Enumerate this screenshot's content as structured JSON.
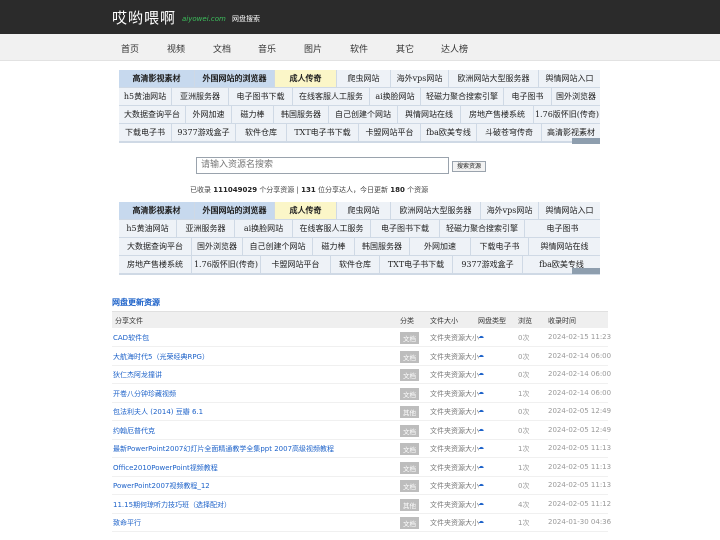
{
  "header": {
    "brand": "哎哟喂啊",
    "brand_sub": "aiyowei.com",
    "tagline": "网盘搜索"
  },
  "nav": [
    "首页",
    "视频",
    "文档",
    "音乐",
    "图片",
    "软件",
    "其它",
    "达人榜"
  ],
  "link_grid_top": [
    [
      "高清影视素材",
      "外国网站的浏览器",
      "成人传奇",
      "爬虫网站",
      "海外vps网站",
      "欧洲网站大型服务器",
      "舆情网站入口"
    ],
    [
      "h5黄油网站",
      "亚洲服务器",
      "电子图书下载",
      "在线客服人工服务",
      "ai换脸网站",
      "轻磁力聚合搜索引擎",
      "电子图书",
      "国外浏览器"
    ],
    [
      "大数据查询平台",
      "外网加速",
      "磁力棒",
      "韩国服务器",
      "自己创建个网站",
      "舆情网站在线",
      "房地产售楼系统",
      "1.76版怀旧(传奇)"
    ],
    [
      "下载电子书",
      "9377游戏盒子",
      "软件仓库",
      "TXT电子书下载",
      "卡盟网站平台",
      "fba欧美专线",
      "斗破苍穹传奇",
      "高清影视素材"
    ]
  ],
  "search": {
    "placeholder": "请输入资源名搜索",
    "button": "搜索资源"
  },
  "stats": {
    "prefix": "已收录",
    "resources": "111049029",
    "mid1": "个分享资源 |",
    "users": "131",
    "mid2": "位分享达人，今日更新",
    "today": "180",
    "suffix": "个资源"
  },
  "link_grid_bottom": [
    [
      "高清影视素材",
      "外国网站的浏览器",
      "成人传奇",
      "爬虫网站",
      "欧洲网站大型服务器",
      "海外vps网站",
      "舆情网站入口"
    ],
    [
      "h5黄油网站",
      "亚洲服务器",
      "ai换脸网站",
      "在线客服人工服务",
      "电子图书下载",
      "轻磁力聚合搜索引擎",
      "电子图书"
    ],
    [
      "大数据查询平台",
      "国外浏览器",
      "自己创建个网站",
      "磁力棒",
      "韩国服务器",
      "外网加速",
      "下载电子书",
      "舆情网站在线"
    ],
    [
      "房地产售楼系统",
      "1.76版怀旧(传奇)",
      "卡盟网站平台",
      "软件仓库",
      "TXT电子书下载",
      "9377游戏盒子",
      "fba欧美专线"
    ]
  ],
  "table": {
    "title": "网盘更新资源",
    "headers": [
      "分享文件",
      "分类",
      "文件大小",
      "网盘类型",
      "浏览",
      "收录时间"
    ],
    "rows": [
      {
        "name": "CAD软件包",
        "cat": "文档",
        "size": "文件夹资源大小",
        "views": "0次",
        "time": "2024-02-15 11:23"
      },
      {
        "name": "大航海时代5（光荣经典RPG）",
        "cat": "文档",
        "size": "文件夹资源大小",
        "views": "0次",
        "time": "2024-02-14 06:00"
      },
      {
        "name": "狄仁杰阿龙撞讲",
        "cat": "文档",
        "size": "文件夹资源大小",
        "views": "0次",
        "time": "2024-02-14 06:00"
      },
      {
        "name": "开卷八分钟珍藏视频",
        "cat": "文档",
        "size": "文件夹资源大小",
        "views": "1次",
        "time": "2024-02-14 06:00"
      },
      {
        "name": "包法利夫人 (2014) 豆瓣 6.1",
        "cat": "其他",
        "size": "文件夹资源大小",
        "views": "0次",
        "time": "2024-02-05 12:49"
      },
      {
        "name": "约翰厄普代克",
        "cat": "文档",
        "size": "文件夹资源大小",
        "views": "0次",
        "time": "2024-02-05 12:49"
      },
      {
        "name": "最新PowerPoint2007幻灯片全面精通教学全集ppt 2007高级视频教程",
        "cat": "文档",
        "size": "文件夹资源大小",
        "views": "1次",
        "time": "2024-02-05 11:13"
      },
      {
        "name": "Office2010PowerPoint视频教程",
        "cat": "文档",
        "size": "文件夹资源大小",
        "views": "1次",
        "time": "2024-02-05 11:13"
      },
      {
        "name": "PowerPoint2007视频教程_12",
        "cat": "文档",
        "size": "文件夹资源大小",
        "views": "0次",
        "time": "2024-02-05 11:13"
      },
      {
        "name": "11.15期何琼听力技巧班（选择配对）",
        "cat": "其他",
        "size": "文件夹资源大小",
        "views": "4次",
        "time": "2024-02-05 11:12"
      },
      {
        "name": "致命平行",
        "cat": "文档",
        "size": "文件夹资源大小",
        "views": "1次",
        "time": "2024-01-30 04:36"
      }
    ]
  }
}
